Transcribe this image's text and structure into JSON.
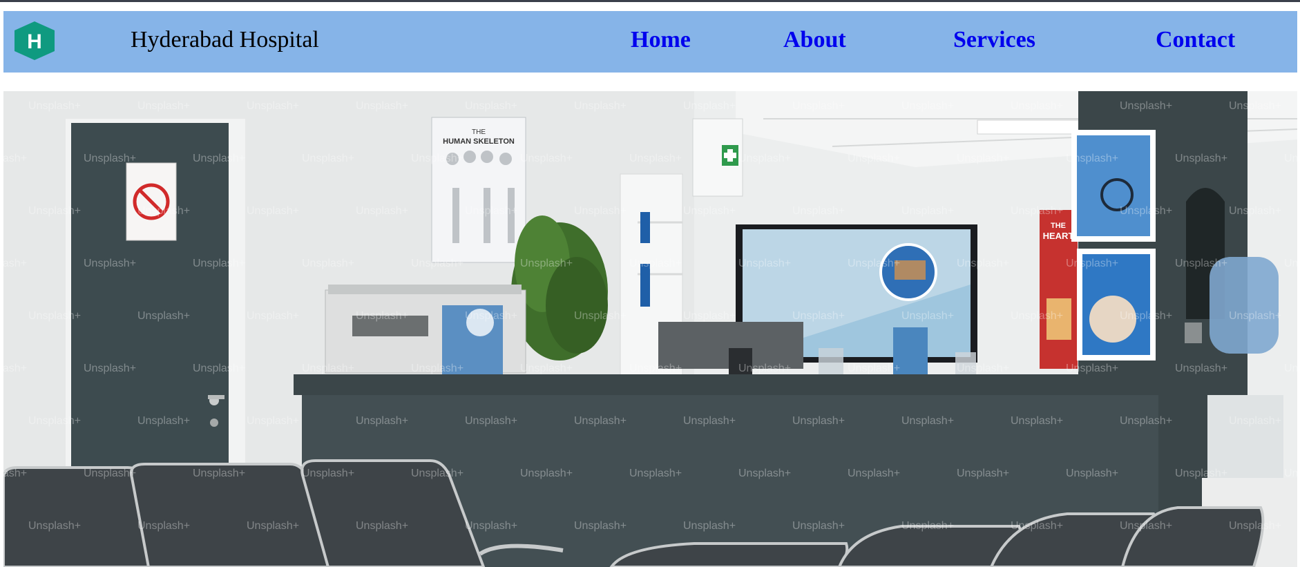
{
  "header": {
    "logo_letter": "H",
    "brand": "Hyderabad Hospital",
    "nav": [
      {
        "label": "Home"
      },
      {
        "label": "About"
      },
      {
        "label": "Services"
      },
      {
        "label": "Contact"
      }
    ]
  },
  "hero": {
    "watermark": "Unsplash+",
    "poster_skeleton_small": "THE",
    "poster_skeleton_title": "HUMAN SKELETON",
    "poster_heart_small": "THE",
    "poster_heart_title": "HEART"
  },
  "colors": {
    "navbar": "#86b4e8",
    "link": "#0000ee",
    "logo": "#0f9a80"
  }
}
